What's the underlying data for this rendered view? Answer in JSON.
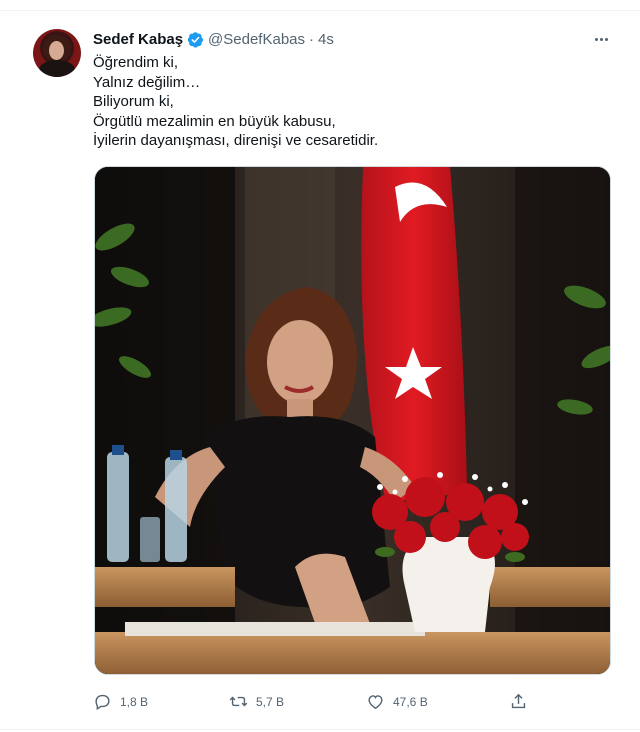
{
  "tweet": {
    "author_name": "Sedef Kabaş",
    "handle": "@SedefKabas",
    "separator": "·",
    "time": "4s",
    "verified": true,
    "lines": [
      "Öğrendim ki,",
      "Yalnız değilim…",
      "Biliyorum ki,",
      "Örgütlü mezalimin en büyük kabusu,",
      "İyilerin dayanışması, direnişi ve cesaretidir."
    ],
    "stats": {
      "replies": "1,8 B",
      "retweets": "5,7 B",
      "likes": "47,6 B"
    }
  },
  "icons": {
    "verified": "verified-badge-icon",
    "more": "more-options-icon",
    "reply": "reply-icon",
    "retweet": "retweet-icon",
    "like": "heart-icon",
    "share": "share-icon"
  },
  "colors": {
    "verified": "#1d9bf0",
    "text": "#0f1419",
    "secondary": "#536471",
    "border": "#cfd9de"
  }
}
